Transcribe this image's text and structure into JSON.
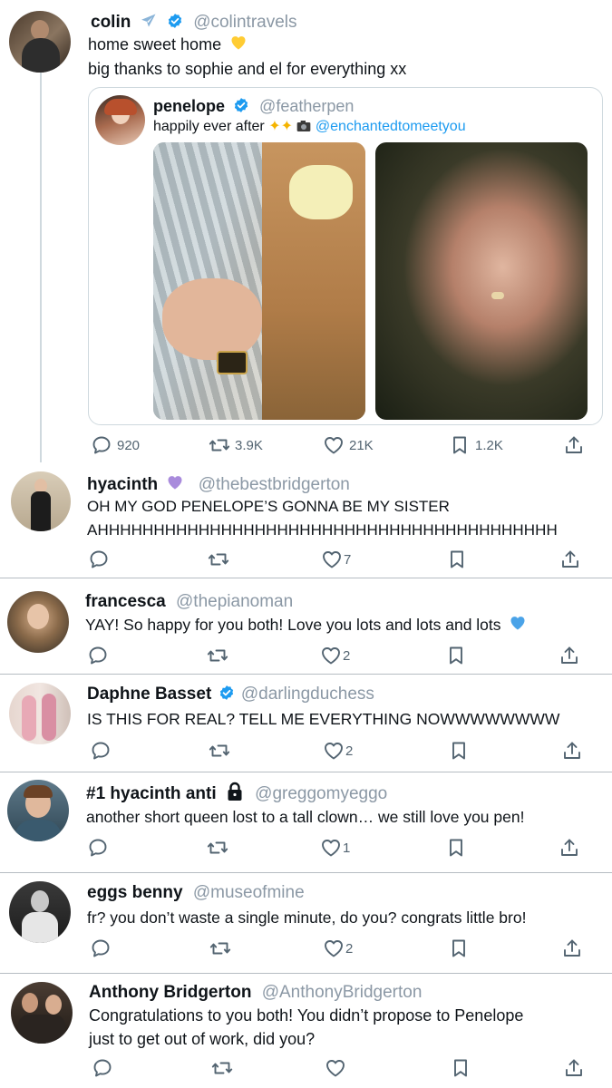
{
  "main_post": {
    "name": "colin",
    "handle": "@colintravels",
    "name_icon": "airplane-emoji",
    "line1": "home sweet home",
    "line1_emoji": "yellow-heart-emoji",
    "line2": "big thanks to sophie and el for everything xx",
    "quote": {
      "name": "penelope",
      "handle": "@featherpen",
      "text": "happily ever after",
      "text_emojis": [
        "sparkles-emoji",
        "sparkles-emoji",
        "camera-emoji"
      ],
      "mention": "@enchantedtomeetyou",
      "images": [
        "couple-embrace-photo",
        "ring-hand-photo"
      ]
    },
    "stats": {
      "replies": "920",
      "reposts": "3.9K",
      "likes": "21K",
      "bookmarks": "1.2K"
    }
  },
  "replies": [
    {
      "name": "hyacinth",
      "handle": "@thebestbridgerton",
      "badge": "purple-heart-emoji",
      "lines": [
        "OH MY GOD PENELOPE’S GONNA BE MY SISTER",
        "AHHHHHHHHHHHHHHHHHHHHHHHHHHHHHHHHHHHHHHHHH"
      ],
      "likes": "7"
    },
    {
      "name": "francesca",
      "handle": "@thepianoman",
      "lines": [
        "YAY! So happy for you both! Love you lots and lots and lots"
      ],
      "line_emoji": "blue-heart-emoji",
      "likes": "2"
    },
    {
      "name": "Daphne Basset",
      "handle": "@darlingduchess",
      "badge": "verified-badge",
      "lines": [
        "IS THIS FOR REAL? TELL ME EVERYTHING NOWWWWWWWW"
      ],
      "likes": "2"
    },
    {
      "name": "#1 hyacinth anti",
      "handle": "@greggomyeggo",
      "badge": "lock-icon",
      "lines": [
        "another short queen lost to a tall clown… we still love you pen!"
      ],
      "likes": "1"
    },
    {
      "name": "eggs benny",
      "handle": "@museofmine",
      "lines": [
        "fr? you don’t waste a single minute, do you? congrats little bro!"
      ],
      "likes": "2"
    },
    {
      "name": "Anthony Bridgerton",
      "handle": "@AnthonyBridgerton",
      "lines": [
        "Congratulations to you both! You didn’t propose to Penelope",
        "just to get out of work, did you?"
      ],
      "likes": ""
    }
  ],
  "colors": {
    "verified": "#1d9bf0",
    "link": "#1d9bf0",
    "icon": "#536471",
    "handle": "#8b98a5",
    "divider": "#b5bcc2"
  }
}
